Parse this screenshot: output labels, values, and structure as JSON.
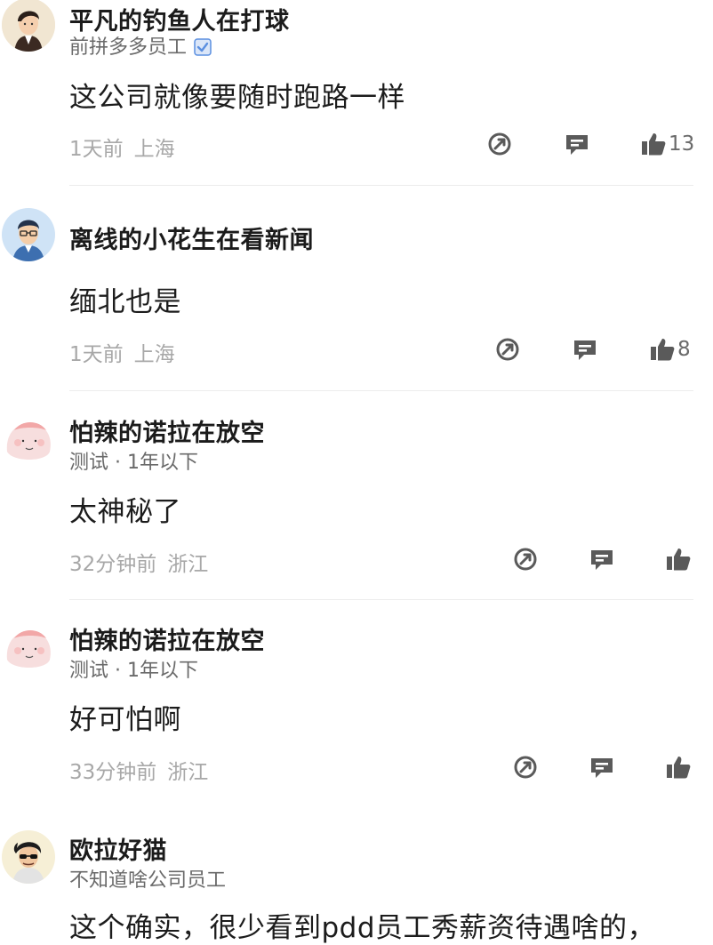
{
  "colors": {
    "username": "#1b1b1b",
    "meta": "#6a6a6a",
    "footer": "#a8a8a8",
    "icon": "#5a5a5a",
    "badge": "#5b8fe0",
    "divider": "#ececec"
  },
  "comments": [
    {
      "username": "平凡的钓鱼人在打球",
      "meta": "前拼多多员工",
      "verified_icon": "verified-badge-icon",
      "text": "这公司就像要随时跑路一样",
      "time": "1天前",
      "location": "上海",
      "likes": "13",
      "avatar_icon": "avatar-cartoon-man-icon"
    },
    {
      "username": "离线的小花生在看新闻",
      "text": "缅北也是",
      "time": "1天前",
      "location": "上海",
      "likes": "8",
      "avatar_icon": "avatar-glasses-man-icon"
    },
    {
      "username": "怕辣的诺拉在放空",
      "meta": "测试 · 1年以下",
      "text": "太神秘了",
      "time": "32分钟前",
      "location": "浙江",
      "avatar_icon": "avatar-pink-blob-icon"
    },
    {
      "username": "怕辣的诺拉在放空",
      "meta": "测试 · 1年以下",
      "text": "好可怕啊",
      "time": "33分钟前",
      "location": "浙江",
      "avatar_icon": "avatar-pink-blob-icon"
    },
    {
      "username": "欧拉好猫",
      "meta": "不知道啥公司员工",
      "text": "这个确实，很少看到pdd员工秀薪资待遇啥的，",
      "avatar_icon": "avatar-sunglasses-man-icon"
    }
  ]
}
